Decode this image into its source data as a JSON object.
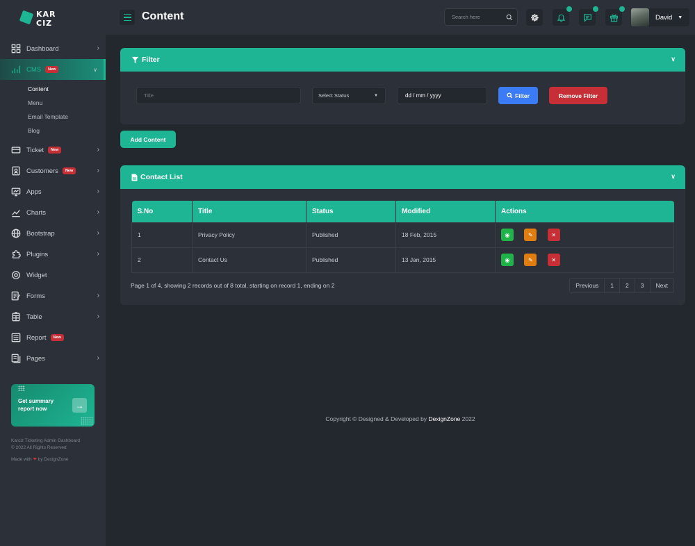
{
  "brand": {
    "line1": "KAR",
    "line2": "CIZ"
  },
  "sidebar": {
    "items": [
      {
        "label": "Dashboard",
        "icon": "dashboard-icon",
        "chevron": ">"
      },
      {
        "label": "CMS",
        "icon": "bar-chart-icon",
        "badge": "New",
        "chevron": "v"
      },
      {
        "label": "Ticket",
        "icon": "ticket-icon",
        "badge": "New",
        "chevron": ">"
      },
      {
        "label": "Customers",
        "icon": "id-card-icon",
        "badge": "New",
        "chevron": ">"
      },
      {
        "label": "Apps",
        "icon": "monitor-icon",
        "chevron": ">"
      },
      {
        "label": "Charts",
        "icon": "line-chart-icon",
        "chevron": ">"
      },
      {
        "label": "Bootstrap",
        "icon": "globe-icon",
        "chevron": ">"
      },
      {
        "label": "Plugins",
        "icon": "puzzle-icon",
        "chevron": ">"
      },
      {
        "label": "Widget",
        "icon": "gear-icon"
      },
      {
        "label": "Forms",
        "icon": "form-icon",
        "chevron": ">"
      },
      {
        "label": "Table",
        "icon": "table-icon",
        "chevron": ">"
      },
      {
        "label": "Report",
        "icon": "report-icon",
        "badge": "New"
      },
      {
        "label": "Pages",
        "icon": "pages-icon",
        "chevron": ">"
      }
    ],
    "cms_sub": [
      "Content",
      "Menu",
      "Email Template",
      "Blog"
    ],
    "promo": {
      "line1": "Get summary",
      "line2": "report now",
      "arrow": "→"
    },
    "footer_line1": "Karciz Ticketing Admin Dashboard",
    "footer_line2": "© 2022 All Rights Reserved",
    "made_prefix": "Made with",
    "made_heart": "❤",
    "made_suffix": "by DexignZone"
  },
  "header": {
    "title": "Content",
    "search_placeholder": "Search here",
    "user_name": "David"
  },
  "filter": {
    "heading": "Filter",
    "title_placeholder": "Title",
    "status_label": "Select Status",
    "date_placeholder": "dd / mm / yyyy",
    "filter_btn": "Filter",
    "remove_btn": "Remove Filter"
  },
  "add_content": "Add Content",
  "contact": {
    "heading": "Contact List",
    "columns": [
      "S.No",
      "Title",
      "Status",
      "Modified",
      "Actions"
    ],
    "rows": [
      {
        "sno": "1",
        "title": "Privacy Policy",
        "status": "Published",
        "modified": "18 Feb, 2015"
      },
      {
        "sno": "2",
        "title": "Contact Us",
        "status": "Published",
        "modified": "13 Jan, 2015"
      }
    ],
    "pager_info": "Page 1 of 4, showing 2 records out of 8 total, starting on record 1, ending on 2",
    "pager": [
      "Previous",
      "1",
      "2",
      "3",
      "Next"
    ]
  },
  "footer": {
    "prefix": "Copyright © Designed & Developed by",
    "brand": "DexignZone",
    "year": "2022"
  },
  "colors": {
    "accent": "#1db593",
    "danger": "#c62f35",
    "primary": "#3b7bf5",
    "warning": "#e07d10",
    "success": "#1fb34a"
  }
}
